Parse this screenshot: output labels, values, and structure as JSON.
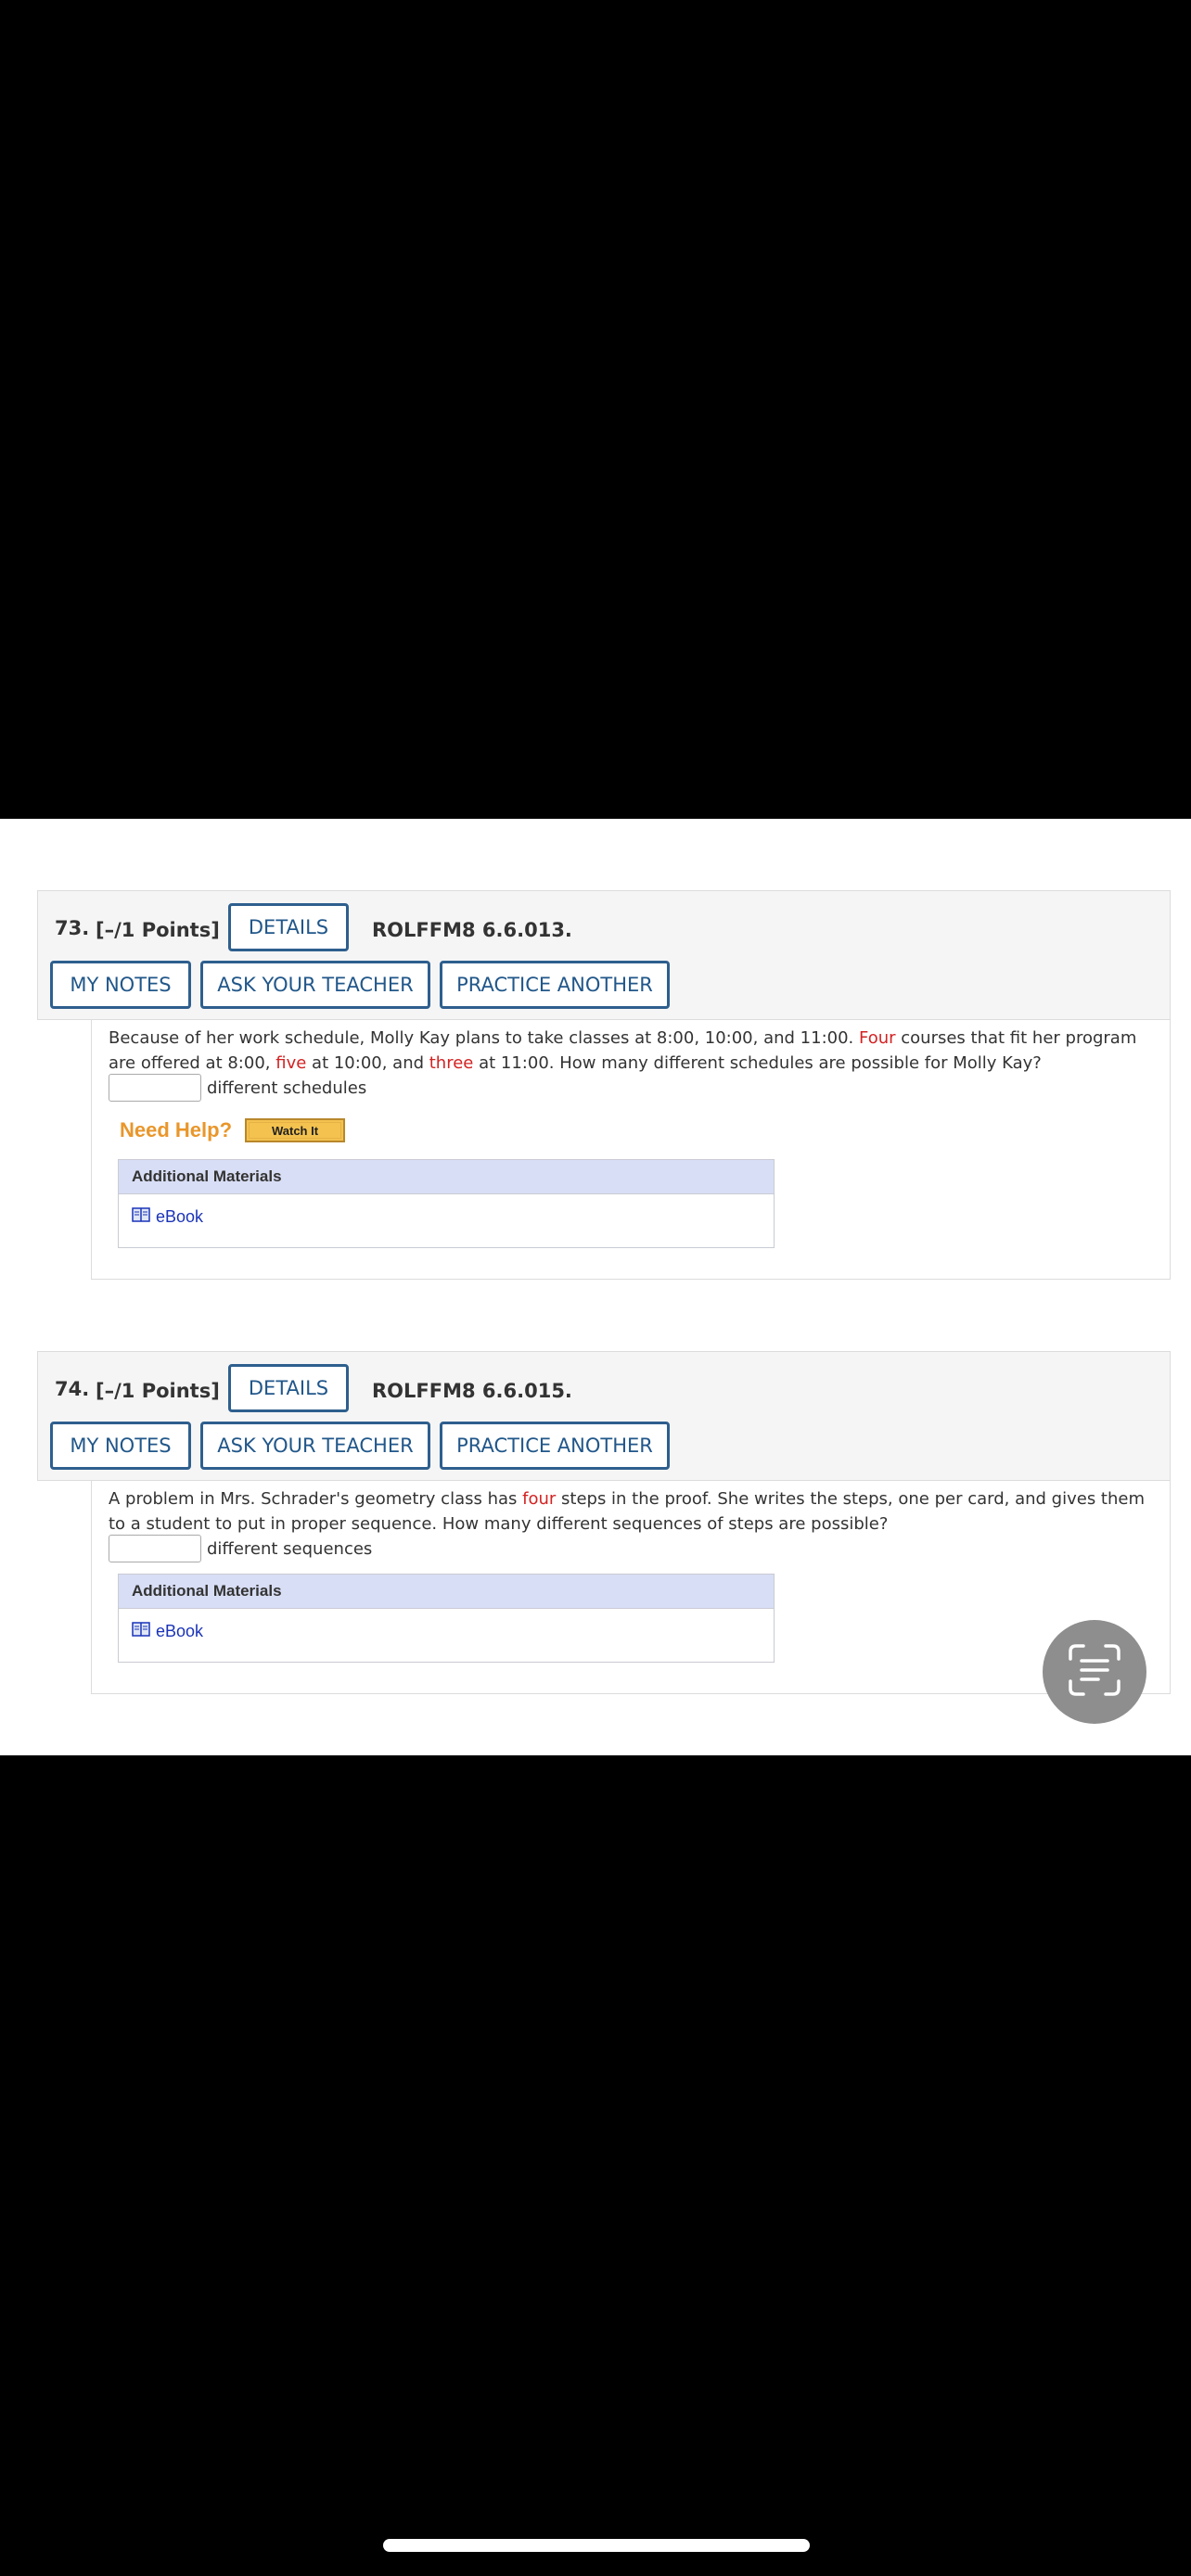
{
  "questions": [
    {
      "number": "73.",
      "points": "[–/1 Points]",
      "details_label": "DETAILS",
      "code": "ROLFFM8 6.6.013.",
      "my_notes_label": "MY NOTES",
      "ask_teacher_label": "ASK YOUR TEACHER",
      "practice_label": "PRACTICE ANOTHER",
      "text": {
        "p1": "Because of her work schedule, Molly Kay plans to take classes at 8:00, 10:00, and 11:00. ",
        "r1": "Four",
        "p2": " courses that fit her program are offered at 8:00, ",
        "r2": "five",
        "p3": " at 10:00, and ",
        "r3": "three",
        "p4": " at 11:00. How many different schedules are possible for Molly Kay?"
      },
      "answer_suffix": "different schedules",
      "need_help_label": "Need Help?",
      "watch_it_label": "Watch It",
      "materials_header": "Additional Materials",
      "ebook_label": "eBook"
    },
    {
      "number": "74.",
      "points": "[–/1 Points]",
      "details_label": "DETAILS",
      "code": "ROLFFM8 6.6.015.",
      "my_notes_label": "MY NOTES",
      "ask_teacher_label": "ASK YOUR TEACHER",
      "practice_label": "PRACTICE ANOTHER",
      "text": {
        "p1": "A problem in Mrs. Schrader's geometry class has ",
        "r1": "four",
        "p2": " steps in the proof. She writes the steps, one per card, and gives them to a student to put in proper sequence. How many different sequences of steps are possible?"
      },
      "answer_suffix": "different sequences",
      "materials_header": "Additional Materials",
      "ebook_label": "eBook"
    }
  ],
  "colors": {
    "accent_button": "#2e5f8e",
    "highlight_red": "#d32222",
    "need_help_orange": "#e9962a",
    "materials_header_bg": "#d8def5",
    "link_blue": "#1a33b8"
  },
  "icons": {
    "ebook": "book-icon",
    "scan": "text-scan-icon"
  }
}
